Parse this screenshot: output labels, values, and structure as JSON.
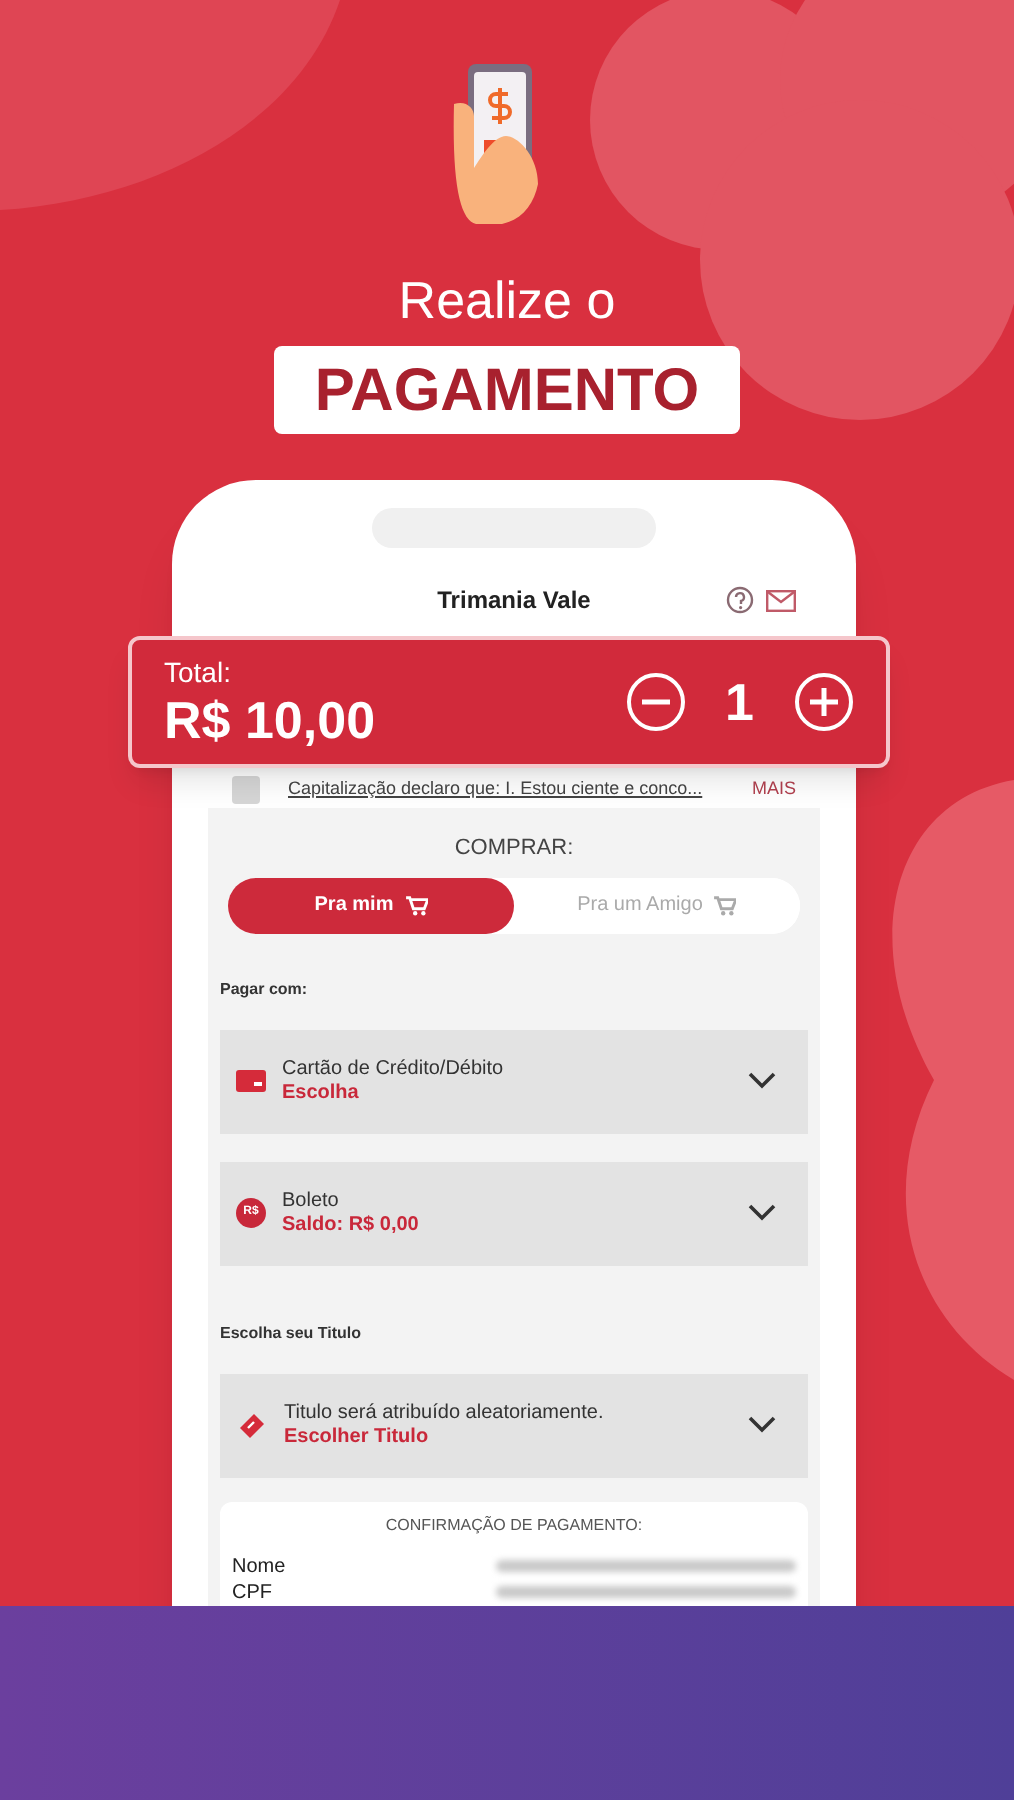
{
  "headline": {
    "line_1": "Realize o",
    "line_2": "PAGAMENTO"
  },
  "app": {
    "title": "Trimania Vale",
    "terms": {
      "text": "Capitalização declaro que: I. Estou ciente e conco...",
      "more": "MAIS",
      "checked": false
    },
    "buy": {
      "label": "COMPRAR:",
      "tabs": [
        {
          "label": "Pra mim",
          "selected": true
        },
        {
          "label": "Pra um Amigo",
          "selected": false
        }
      ]
    },
    "pay_label": "Pagar com:",
    "payment_options": [
      {
        "kind": "card",
        "title": "Cartão de Crédito/Débito",
        "subtitle": "Escolha"
      },
      {
        "kind": "boleto",
        "icon_text": "R$",
        "title": "Boleto",
        "subtitle": "Saldo: R$ 0,00"
      }
    ],
    "title_label": "Escolha seu Titulo",
    "title_option": {
      "kind": "ticket",
      "title": "Titulo será atribuído aleatoriamente.",
      "subtitle": "Escolher Titulo"
    },
    "confirmation": {
      "heading": "CONFIRMAÇÃO DE PAGAMENTO:",
      "rows": [
        {
          "label": "Nome"
        },
        {
          "label": "CPF"
        }
      ]
    }
  },
  "total_bar": {
    "label": "Total:",
    "amount": "R$ 10,00",
    "quantity": "1"
  }
}
